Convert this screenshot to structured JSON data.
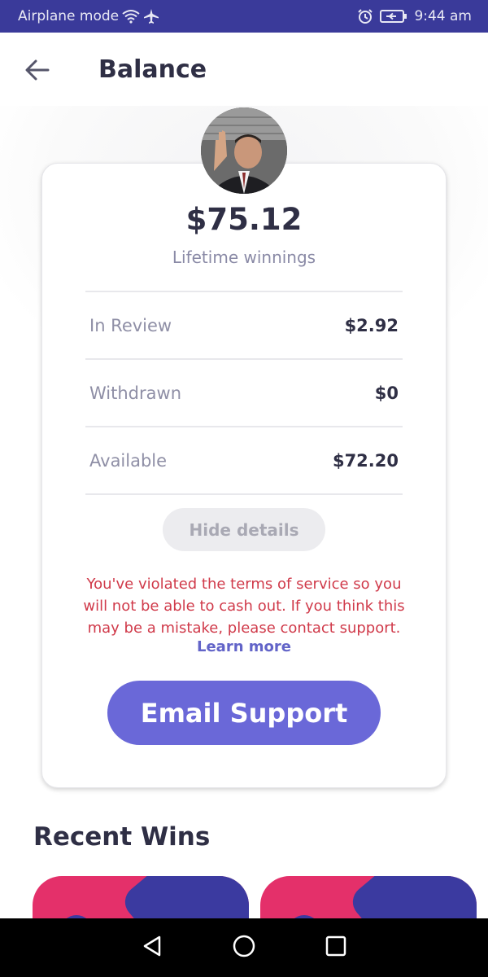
{
  "status_bar": {
    "left_text": "Airplane mode",
    "time": "9:44 am",
    "icons": [
      "wifi-icon",
      "airplane-icon",
      "alarm-icon",
      "battery-icon"
    ]
  },
  "header": {
    "back_icon": "arrow-left-icon",
    "title": "Balance"
  },
  "balance": {
    "amount": "$75.12",
    "caption": "Lifetime winnings",
    "details": [
      {
        "label": "In Review",
        "value": "$2.92"
      },
      {
        "label": "Withdrawn",
        "value": "$0"
      },
      {
        "label": "Available",
        "value": "$72.20"
      }
    ],
    "hide_details_label": "Hide details",
    "warning": "You've violated the terms of service so you will not be able to cash out. If you think this may be a mistake, please contact support.",
    "learn_more": "Learn more",
    "email_support_label": "Email Support"
  },
  "recent_wins": {
    "title": "Recent Wins"
  },
  "colors": {
    "status_bar": "#3a3a9a",
    "accent": "#6a68d8",
    "warning": "#d03a4a",
    "card_pink": "#e4306a",
    "card_indigo": "#3b3aa0"
  },
  "nav_bar": {
    "icons": [
      "back-triangle-icon",
      "home-circle-icon",
      "recents-square-icon"
    ]
  }
}
